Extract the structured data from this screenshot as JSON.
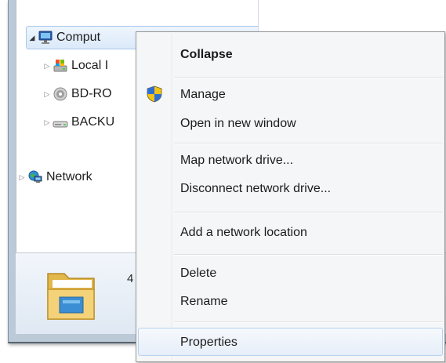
{
  "tree": {
    "items": [
      {
        "label": "Comput",
        "icon": "computer-icon",
        "expander": "open"
      },
      {
        "label": "Local I",
        "icon": "local-disk-icon",
        "expander": "closed"
      },
      {
        "label": "BD-RO",
        "icon": "optical-drive-icon",
        "expander": "closed"
      },
      {
        "label": "BACKU",
        "icon": "removable-drive-icon",
        "expander": "closed"
      },
      {
        "label": "Network",
        "icon": "network-icon",
        "expander": "closed"
      }
    ]
  },
  "details": {
    "count_text": "4",
    "icon": "folder-icon"
  },
  "context_menu": {
    "items": [
      {
        "label": "Collapse",
        "bold": true
      },
      {
        "label": "Manage",
        "icon": "uac-shield-icon"
      },
      {
        "label": "Open in new window"
      },
      {
        "label": "Map network drive..."
      },
      {
        "label": "Disconnect network drive..."
      },
      {
        "label": "Add a network location"
      },
      {
        "label": "Delete"
      },
      {
        "label": "Rename"
      },
      {
        "label": "Properties",
        "highlighted": true
      }
    ]
  },
  "colors": {
    "menu_background": "#f5f6f7",
    "highlight_border": "#b8d2ee",
    "selection_border": "#a9c8ed",
    "frame": "#bcc9d7"
  }
}
